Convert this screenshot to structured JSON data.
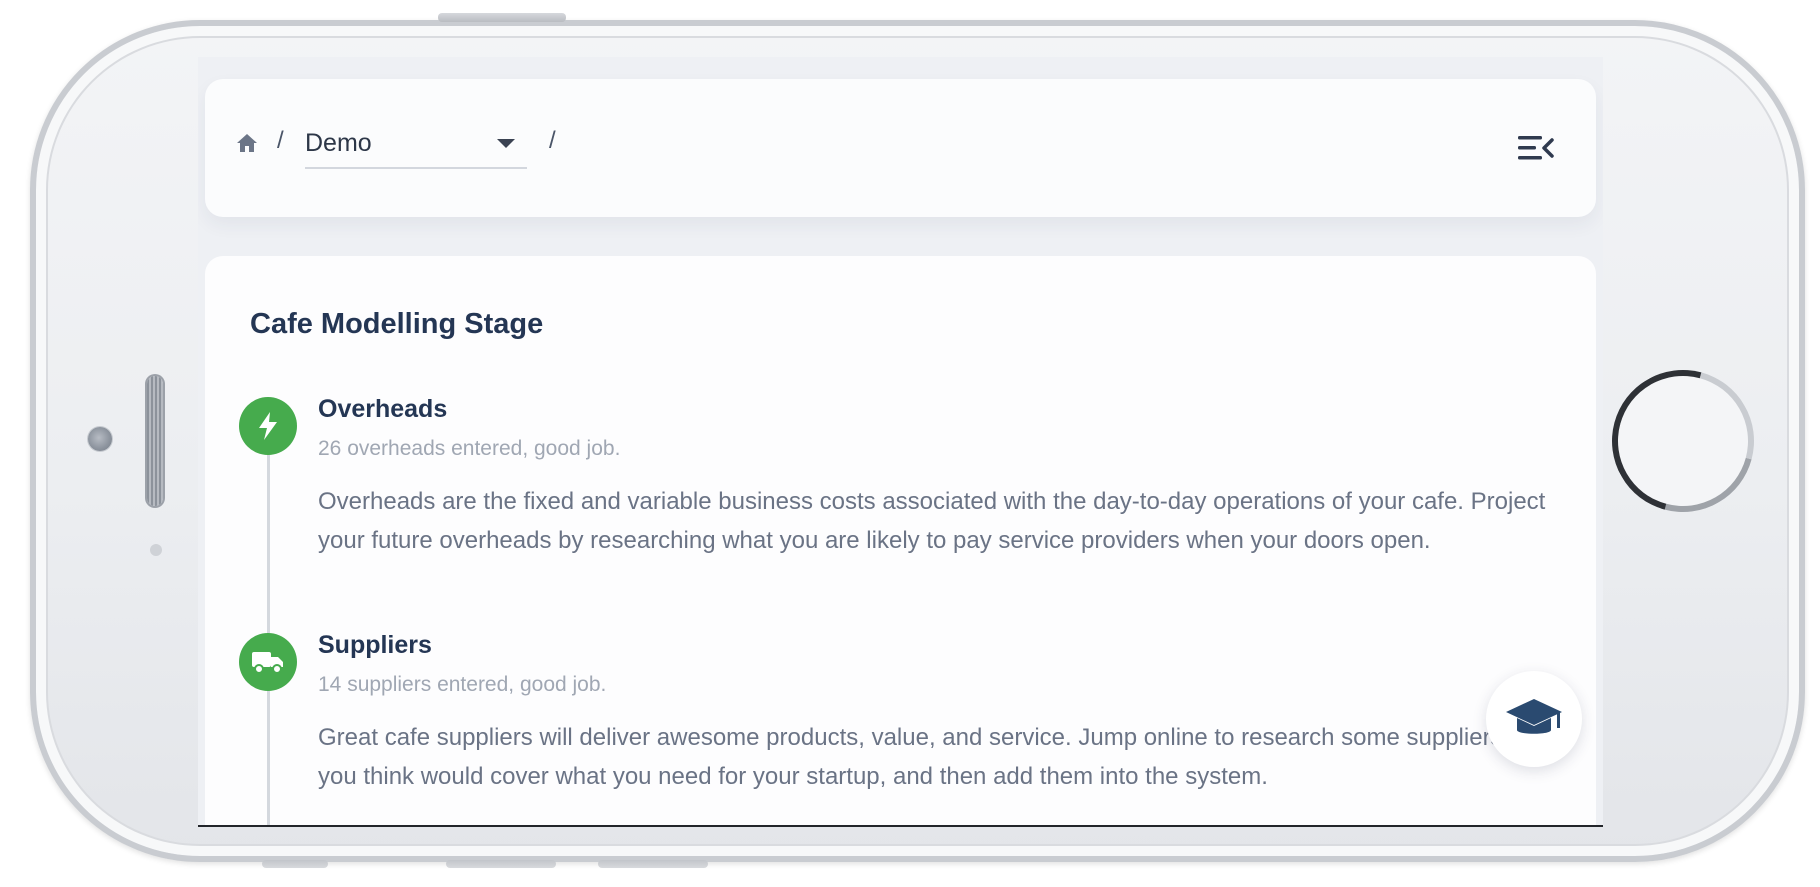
{
  "breadcrumb": {
    "separator": "/",
    "selected_option": "Demo"
  },
  "card": {
    "title": "Cafe Modelling Stage"
  },
  "steps": [
    {
      "icon": "lightning-icon",
      "title": "Overheads",
      "status": "26 overheads entered, good job.",
      "description": "Overheads are the fixed and variable business costs associated with the day-to-day operations of your cafe. Project your future overheads by researching what you are likely to pay service providers when your doors open."
    },
    {
      "icon": "truck-icon",
      "title": "Suppliers",
      "status": "14 suppliers entered, good job.",
      "description": "Great cafe suppliers will deliver awesome products, value, and service. Jump online to research some suppliers that you think would cover what you need for your startup, and then add them into the system."
    }
  ],
  "colors": {
    "accent_green": "#46ab4d",
    "title_navy": "#243654",
    "muted_text": "#a0a7b3",
    "body_text": "#6a7385"
  },
  "icons": {
    "home": "home-icon",
    "dropdown": "chevron-down-icon",
    "menu": "menu-collapse-icon",
    "help": "graduation-cap-icon"
  }
}
